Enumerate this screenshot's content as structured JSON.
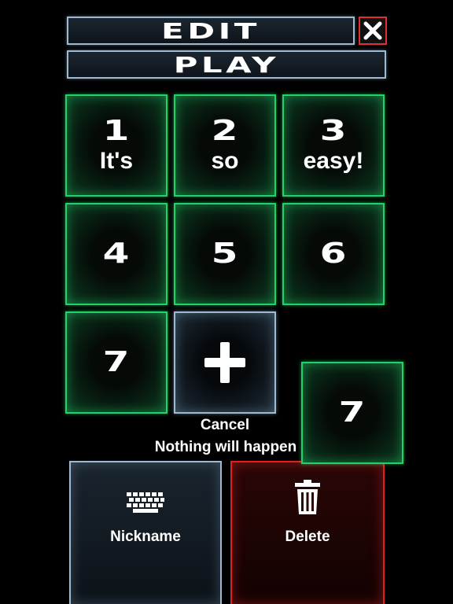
{
  "header": {
    "edit_label": "EDIT",
    "play_label": "PLAY"
  },
  "tiles": [
    {
      "number": "1",
      "text": "It's"
    },
    {
      "number": "2",
      "text": "so"
    },
    {
      "number": "3",
      "text": "easy!"
    },
    {
      "number": "4",
      "text": ""
    },
    {
      "number": "5",
      "text": ""
    },
    {
      "number": "6",
      "text": ""
    },
    {
      "number": "7",
      "text": ""
    }
  ],
  "dragged_tile": {
    "number": "7"
  },
  "cancel": {
    "title": "Cancel",
    "description": "Nothing will happen"
  },
  "actions": {
    "nickname_label": "Nickname",
    "delete_label": "Delete"
  },
  "icons": {
    "close": "close-icon",
    "add": "plus-icon",
    "nickname": "keyboard-icon",
    "delete": "trash-icon"
  },
  "colors": {
    "tile_border": "#1fd36a",
    "bar_border": "#9fbad0",
    "delete_border": "#e02020",
    "close_border": "#e03030"
  }
}
